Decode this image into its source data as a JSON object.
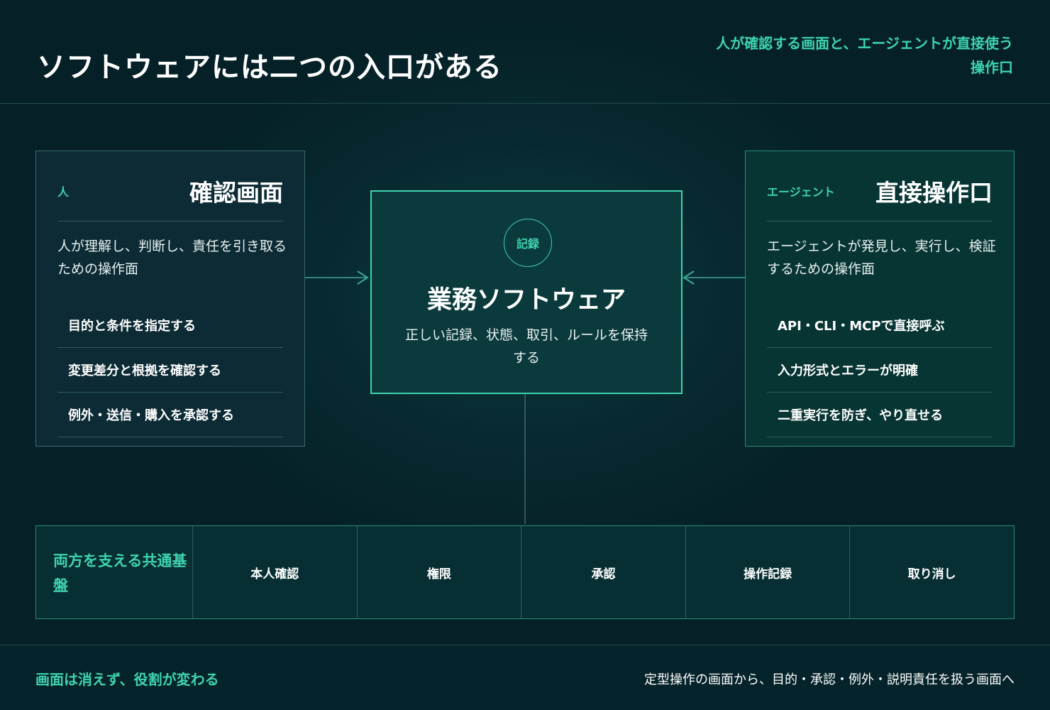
{
  "header": {
    "title": "ソフトウェアには二つの入口がある",
    "subtitle": "人が確認する画面と、エージェントが直接使う操作口"
  },
  "left_card": {
    "role": "人",
    "title": "確認画面",
    "description": "人が理解し、判断し、責任を引き取るための操作面",
    "items": [
      "目的と条件を指定する",
      "変更差分と根拠を確認する",
      "例外・送信・購入を承認する"
    ]
  },
  "center_card": {
    "badge": "記録",
    "title": "業務ソフトウェア",
    "description": "正しい記録、状態、取引、ルールを保持する"
  },
  "right_card": {
    "role": "エージェント",
    "title": "直接操作口",
    "description": "エージェントが発見し、実行し、検証するための操作面",
    "items": [
      "API・CLI・MCPで直接呼ぶ",
      "入力形式とエラーが明確",
      "二重実行を防ぎ、やり直せる"
    ]
  },
  "foundation": {
    "label": "両方を支える共通基盤",
    "cells": [
      "本人確認",
      "権限",
      "承認",
      "操作記録",
      "取り消し"
    ]
  },
  "footer": {
    "left": "画面は消えず、役割が変わる",
    "right": "定型操作の画面から、目的・承認・例外・説明責任を扱う画面へ"
  },
  "colors": {
    "accent": "#3fd3b0",
    "background": "#06262b",
    "border": "#2a8a7e"
  }
}
